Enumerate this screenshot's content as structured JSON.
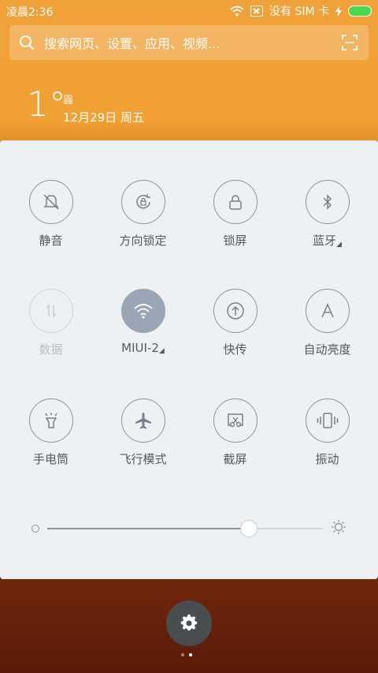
{
  "status_bar": {
    "time": "凌晨2:36",
    "no_sim": "没有 SIM 卡"
  },
  "search": {
    "placeholder": "搜索网页、设置、应用、视频..."
  },
  "weather": {
    "temperature": "1°",
    "condition_icon": "霾",
    "date": "12月29日 周五"
  },
  "quick_settings": {
    "row1": [
      {
        "label": "静音",
        "icon": "mute-bell-icon"
      },
      {
        "label": "方向锁定",
        "icon": "rotation-lock-icon"
      },
      {
        "label": "锁屏",
        "icon": "lock-icon"
      },
      {
        "label": "蓝牙",
        "icon": "bluetooth-icon",
        "has_more": true
      }
    ],
    "row2": [
      {
        "label": "数据",
        "icon": "mobile-data-icon",
        "disabled": true
      },
      {
        "label": "MIUI-2",
        "icon": "wifi-icon",
        "active": true,
        "has_more": true
      },
      {
        "label": "快传",
        "icon": "quick-transfer-icon"
      },
      {
        "label": "自动亮度",
        "icon": "auto-brightness-icon"
      }
    ],
    "row3": [
      {
        "label": "手电筒",
        "icon": "flashlight-icon"
      },
      {
        "label": "飞行模式",
        "icon": "airplane-icon"
      },
      {
        "label": "截屏",
        "icon": "screenshot-icon"
      },
      {
        "label": "振动",
        "icon": "vibrate-icon"
      }
    ]
  },
  "brightness": {
    "level": 0.73
  },
  "colors": {
    "active_tile": "#9aa6b6",
    "panel_bg": "#edf1f3",
    "battery": "#4cd64c"
  },
  "pager": {
    "pages": 2,
    "current": 2
  }
}
